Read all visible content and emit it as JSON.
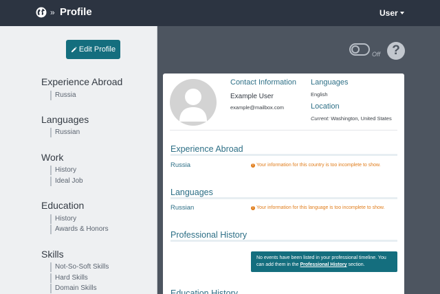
{
  "header": {
    "title": "Profile",
    "breadcrumb_sep": "»",
    "user_menu": "User"
  },
  "sidebar": {
    "edit_button": "Edit Profile",
    "sections": [
      {
        "title": "Experience Abroad",
        "items": [
          "Russia"
        ]
      },
      {
        "title": "Languages",
        "items": [
          "Russian"
        ]
      },
      {
        "title": "Work",
        "items": [
          "History",
          "Ideal Job"
        ]
      },
      {
        "title": "Education",
        "items": [
          "History",
          "Awards & Honors"
        ]
      },
      {
        "title": "Skills",
        "items": [
          "Not-So-Soft Skills",
          "Hard Skills",
          "Domain Skills"
        ]
      }
    ]
  },
  "toggle": {
    "label": "Off"
  },
  "help": {
    "label": "?"
  },
  "profile": {
    "contact_heading": "Contact Information",
    "name": "Example User",
    "email": "example@mailbox.com",
    "languages_heading": "Languages",
    "languages_value": "English",
    "location_heading": "Location",
    "location_prefix": "Current:",
    "location_value": "Washington, United States"
  },
  "sections": {
    "experience": {
      "title": "Experience Abroad",
      "row_label": "Russia",
      "warning": "Your information for this country is too incomplete to show."
    },
    "languages": {
      "title": "Languages",
      "row_label": "Russian",
      "warning": "Your information for this language is too incomplete to show."
    },
    "professional": {
      "title": "Professional History",
      "notice_text": "No events have been listed in your professional timeline. You can add them in the",
      "notice_link": "Professional History",
      "notice_suffix": "section."
    },
    "education": {
      "title": "Education History"
    }
  },
  "colors": {
    "topbar": "#2c3441",
    "accent": "#146e7e",
    "heading": "#2d6f86",
    "warning": "#e07c1a"
  }
}
